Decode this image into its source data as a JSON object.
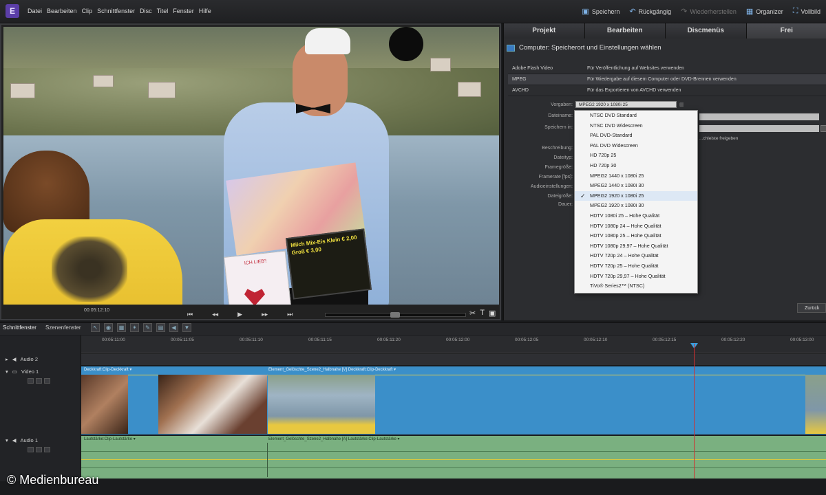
{
  "menubar": {
    "logo": "E",
    "items": [
      "Datei",
      "Bearbeiten",
      "Clip",
      "Schnittfenster",
      "Disc",
      "Titel",
      "Fenster",
      "Hilfe"
    ]
  },
  "toolbar": {
    "save": "Speichern",
    "undo": "Rückgängig",
    "redo": "Wiederherstellen",
    "organizer": "Organizer",
    "fullscreen": "Vollbild"
  },
  "monitor": {
    "timecode": "00:05:12:10",
    "sign_text": "Milch Mix-Eis Klein € 2,00 Groß € 3,00",
    "box_text": "ICH LIEB'!"
  },
  "panel": {
    "tabs": [
      "Projekt",
      "Bearbeiten",
      "Discmenüs",
      "Frei"
    ],
    "title": "Computer: Speicherort und Einstellungen wählen",
    "formats": [
      {
        "name": "Adobe Flash Video",
        "desc": "Für Veröffentlichung auf Websites verwenden"
      },
      {
        "name": "MPEG",
        "desc": "Für Wiedergabe auf diesem Computer oder DVD-Brennen verwenden"
      },
      {
        "name": "AVCHD",
        "desc": "Für das Exportieren von AVCHD verwenden"
      }
    ],
    "presets_label": "Vorgaben:",
    "preset_value": "MPEG2 1920 x 1080i 25",
    "filename_label": "Dateiname:",
    "saveto_label": "Speichern in:",
    "share_text": "...chleiste freigeben",
    "side_labels": [
      "Beschreibung:",
      "Dateityp:",
      "Framegröße:",
      "Framerate [fps]:",
      "Audioeinstellungen:",
      "Dateigröße:",
      "Dauer:"
    ],
    "back_button": "Zurück"
  },
  "dropdown": {
    "items": [
      "NTSC DVD Standard",
      "NTSC DVD Widescreen",
      "PAL DVD-Standard",
      "PAL DVD Widescreen",
      "HD 720p 25",
      "HD 720p 30",
      "MPEG2 1440 x 1080i 25",
      "MPEG2 1440 x 1080i 30",
      "MPEG2 1920 x 1080i 25",
      "MPEG2 1920 x 1080i 30",
      "HDTV 1080i 25 – Hohe Qualität",
      "HDTV 1080p 24 – Hohe Qualität",
      "HDTV 1080p 25 – Hohe Qualität",
      "HDTV 1080p 29,97 – Hohe Qualität",
      "HDTV 720p 24 – Hohe Qualität",
      "HDTV 720p 25 – Hohe Qualität",
      "HDTV 720p 29,97 – Hohe Qualität",
      "TiVo® Series2™ (NTSC)"
    ],
    "selected_index": 8,
    "check": "✓"
  },
  "timeline": {
    "tabs": [
      "Schnittfenster",
      "Szenenfenster"
    ],
    "ruler": [
      "00:05:11:00",
      "00:05:11:05",
      "00:05:11:10",
      "00:05:11:15",
      "00:05:11:20",
      "00:05:12:00",
      "00:05:12:05",
      "00:05:12:10",
      "00:05:12:15",
      "00:05:12:20",
      "00:05:13:00"
    ],
    "tracks": {
      "audio2": "Audio 2",
      "video1": "Video 1",
      "audio1": "Audio 1"
    },
    "clip_labels": {
      "video_a": "Deckkraft:Clip-Deckkraft ▾",
      "video_b": "Element_Gelöschte_Szene2_Halbnahe [V]  Deckkraft:Clip-Deckkraft ▾",
      "audio_a": "Lautstärke:Clip-Lautstärke ▾",
      "audio_b": "Element_Gelöschte_Szene2_Halbnahe [A]  Lautstärke:Clip-Lautstärke ▾"
    }
  },
  "watermark": "© Medienbureau",
  "colors": {
    "video_track": "#3b8fc9",
    "audio_track": "#7ab080",
    "playhead": "#d03030",
    "menu_bg": "#2a2b2e"
  }
}
